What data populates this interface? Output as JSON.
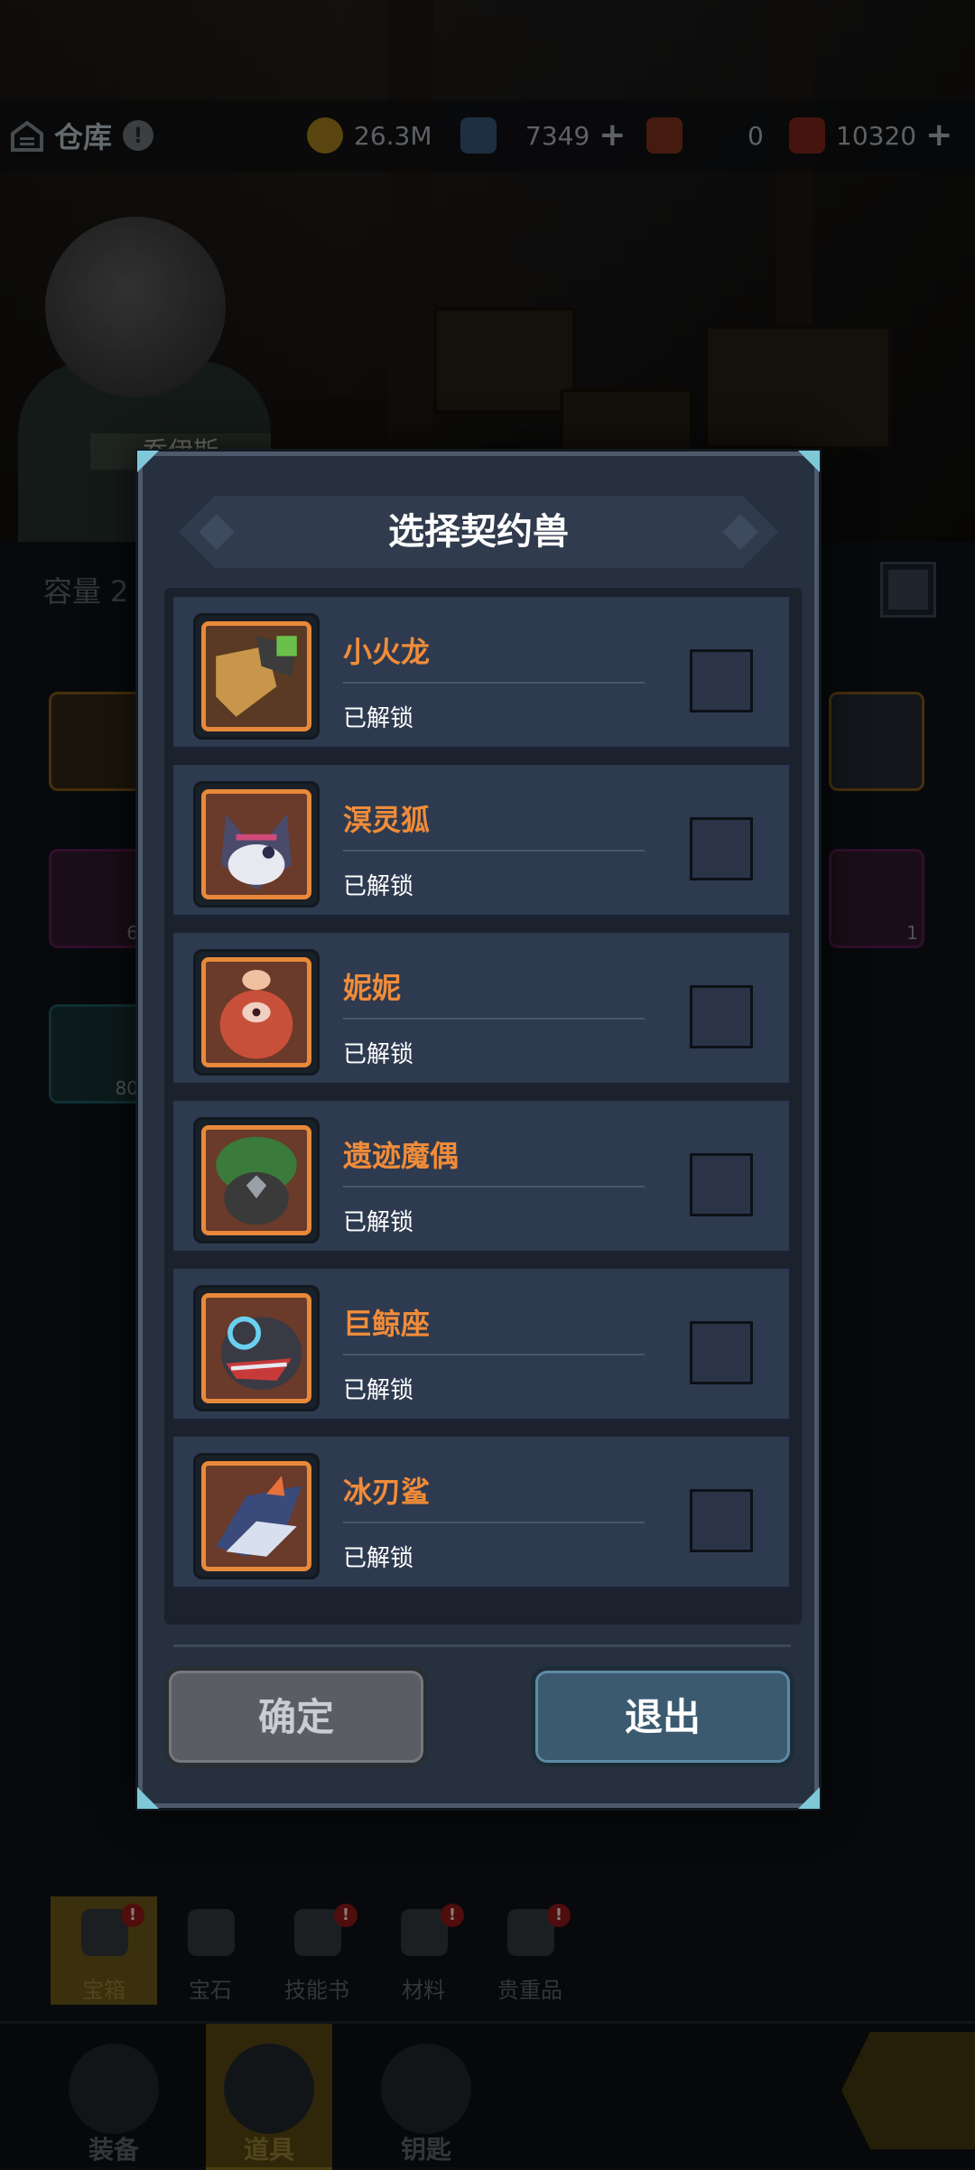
{
  "header": {
    "title": "仓库",
    "info_label": "!",
    "resources": [
      {
        "icon": "gold-coin-icon",
        "value": "26.3M",
        "has_plus": false
      },
      {
        "icon": "blue-crystal-icon",
        "value": "7349",
        "has_plus": true
      },
      {
        "icon": "red-ticket-icon",
        "value": "0",
        "has_plus": false
      },
      {
        "icon": "red-scroll-icon",
        "value": "10320",
        "has_plus": true
      }
    ]
  },
  "background": {
    "character_name": "乔伊斯",
    "capacity_label": "容量 2",
    "slot_counts": [
      "6",
      "80",
      "1"
    ]
  },
  "modal": {
    "title": "选择契约兽",
    "pets": [
      {
        "name": "小火龙",
        "status": "已解锁",
        "icon": "small-fire-dragon-icon",
        "checked": false
      },
      {
        "name": "溟灵狐",
        "status": "已解锁",
        "icon": "spirit-fox-icon",
        "checked": false
      },
      {
        "name": "妮妮",
        "status": "已解锁",
        "icon": "nini-icon",
        "checked": false
      },
      {
        "name": "遗迹魔偶",
        "status": "已解锁",
        "icon": "relic-golem-icon",
        "checked": false
      },
      {
        "name": "巨鲸座",
        "status": "已解锁",
        "icon": "giant-whale-icon",
        "checked": false
      },
      {
        "name": "冰刃鲨",
        "status": "已解锁",
        "icon": "ice-blade-shark-icon",
        "checked": false
      }
    ],
    "confirm_label": "确定",
    "exit_label": "退出"
  },
  "category_tabs": [
    {
      "label": "宝箱",
      "active": true,
      "badge": "!"
    },
    {
      "label": "宝石",
      "active": false,
      "badge": ""
    },
    {
      "label": "技能书",
      "active": false,
      "badge": "!"
    },
    {
      "label": "材料",
      "active": false,
      "badge": "!"
    },
    {
      "label": "贵重品",
      "active": false,
      "badge": "!"
    }
  ],
  "nav": [
    {
      "label": "装备",
      "active": false
    },
    {
      "label": "道具",
      "active": true
    },
    {
      "label": "钥匙",
      "active": false
    }
  ],
  "colors": {
    "pet_name": "#f08c3a",
    "avatar_border": "#e8893a",
    "row_bg": "#2e3a4f",
    "modal_bg": "#27303f"
  }
}
